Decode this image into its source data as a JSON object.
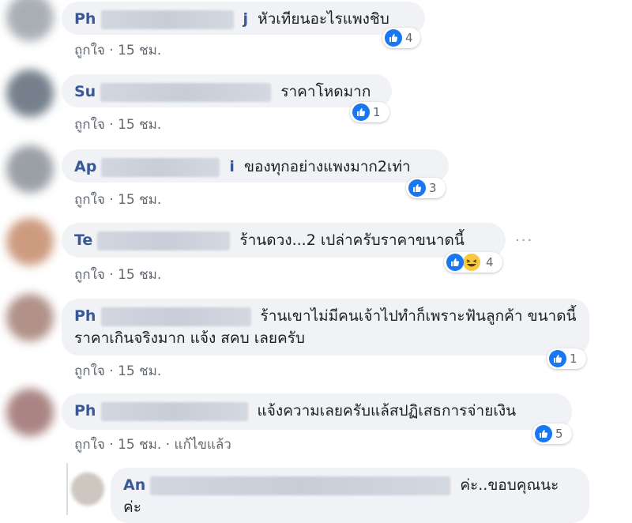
{
  "comments": [
    {
      "author_visible": "Ph",
      "author_tail": "j",
      "text": "หัวเทียนอะไรแพงชิบ",
      "likes_label": "ถูกใจ",
      "time": "15 ชม.",
      "reaction_count": "4"
    },
    {
      "author_visible": "Su",
      "author_tail": "",
      "text": "ราคาโหดมาก",
      "likes_label": "ถูกใจ",
      "time": "15 ชม.",
      "reaction_count": "1"
    },
    {
      "author_visible": "Ap",
      "author_tail": "i",
      "text": "ของทุกอย่างแพงมาก2เท่า",
      "likes_label": "ถูกใจ",
      "time": "15 ชม.",
      "reaction_count": "3"
    },
    {
      "author_visible": "Te",
      "author_tail": "",
      "text": "ร้านดวง...2 เปล่าครับราคาขนาดนี้",
      "likes_label": "ถูกใจ",
      "time": "15 ชม.",
      "reaction_count": "4"
    },
    {
      "author_visible": "Ph",
      "author_tail": "",
      "text": "ร้านเขาไม่มีคนเจ้าไปทำก็เพราะฟันลูกค้า ขนาดนี้ ราคาเกินจริงมาก แจ้ง สคบ เลยครับ",
      "likes_label": "ถูกใจ",
      "time": "15 ชม.",
      "reaction_count": "1"
    },
    {
      "author_visible": "Ph",
      "author_tail": "",
      "text": "แจ้งความเลยครับแล้สปฏิเสธการจ่ายเงิน",
      "likes_label": "ถูกใจ",
      "time": "15 ชม.",
      "edited": "แก้ไขแล้ว",
      "reaction_count": "5"
    }
  ],
  "reply": {
    "author_visible": "An",
    "text": "ค่ะ..ขอบคุณนะค่ะ"
  },
  "separator": "·",
  "more_icon": "ellipsis-icon",
  "colors": {
    "link": "#385898",
    "bubble": "#f0f2f5",
    "like": "#1877f2",
    "haha": "#f7c93f",
    "meta": "#606770"
  }
}
